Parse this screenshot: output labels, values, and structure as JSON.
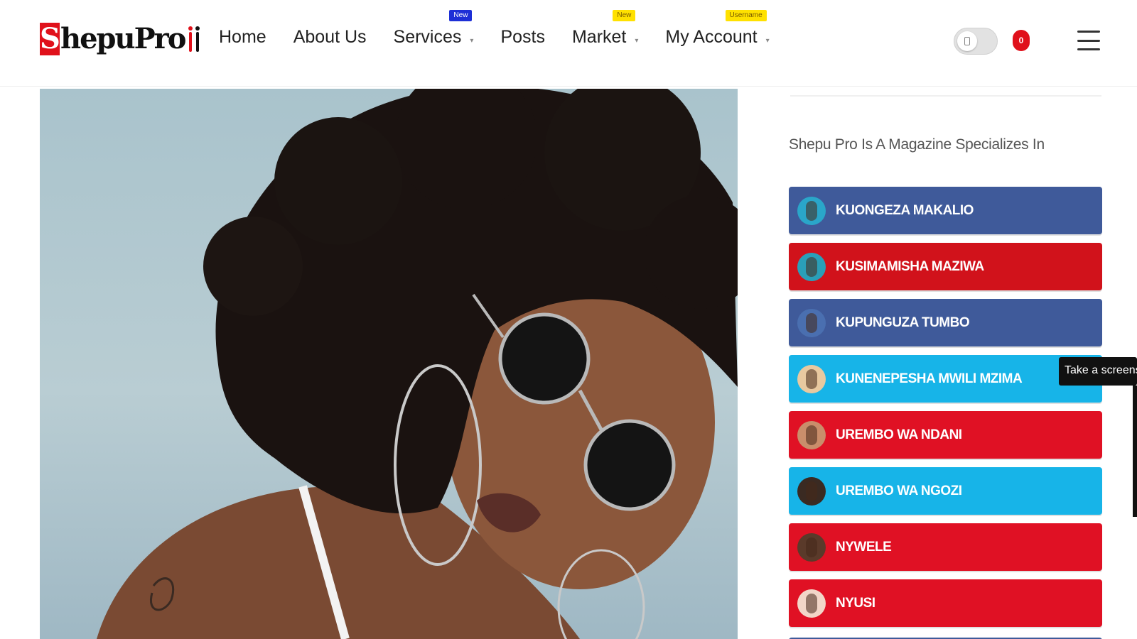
{
  "header": {
    "logo": {
      "letter": "S",
      "text": "hepuPro"
    },
    "nav": [
      {
        "label": "Home",
        "has_caret": false,
        "badge": null
      },
      {
        "label": "About Us",
        "has_caret": false,
        "badge": null
      },
      {
        "label": "Services",
        "has_caret": true,
        "badge": {
          "text": "New",
          "style": "blue"
        }
      },
      {
        "label": "Posts",
        "has_caret": false,
        "badge": null
      },
      {
        "label": "Market",
        "has_caret": true,
        "badge": {
          "text": "New",
          "style": "yellow"
        }
      },
      {
        "label": "My Account",
        "has_caret": true,
        "badge": {
          "text": "Username",
          "style": "yellow"
        }
      }
    ],
    "notification_count": "0",
    "theme_toggle": "off"
  },
  "sidebar": {
    "intro": "Shepu Pro Is A Magazine Specializes In",
    "categories": [
      {
        "label": "KUONGEZA MAKALIO",
        "color": "#3f5a9a",
        "icon": "body-thumbnail"
      },
      {
        "label": "KUSIMAMISHA MAZIWA",
        "color": "#d1121b",
        "icon": "body-thumbnail"
      },
      {
        "label": "KUPUNGUZA TUMBO",
        "color": "#3f5a9a",
        "icon": "body-thumbnail"
      },
      {
        "label": "KUNENEPESHA MWILI MZIMA",
        "color": "#17b4e8",
        "icon": "body-thumbnail"
      },
      {
        "label": "UREMBO WA NDANI",
        "color": "#e01124",
        "icon": "body-thumbnail"
      },
      {
        "label": "UREMBO WA NGOZI",
        "color": "#17b4e8",
        "icon": "face-thumbnail"
      },
      {
        "label": "NYWELE",
        "color": "#e01124",
        "icon": "hair-thumbnail"
      },
      {
        "label": "NYUSI",
        "color": "#e01124",
        "icon": "face-thumbnail"
      }
    ]
  },
  "overlay": {
    "tooltip": "Take a screensh"
  },
  "colors": {
    "brand_red": "#e0111b",
    "badge_blue": "#1d2fd6",
    "badge_yellow": "#ffe100"
  }
}
